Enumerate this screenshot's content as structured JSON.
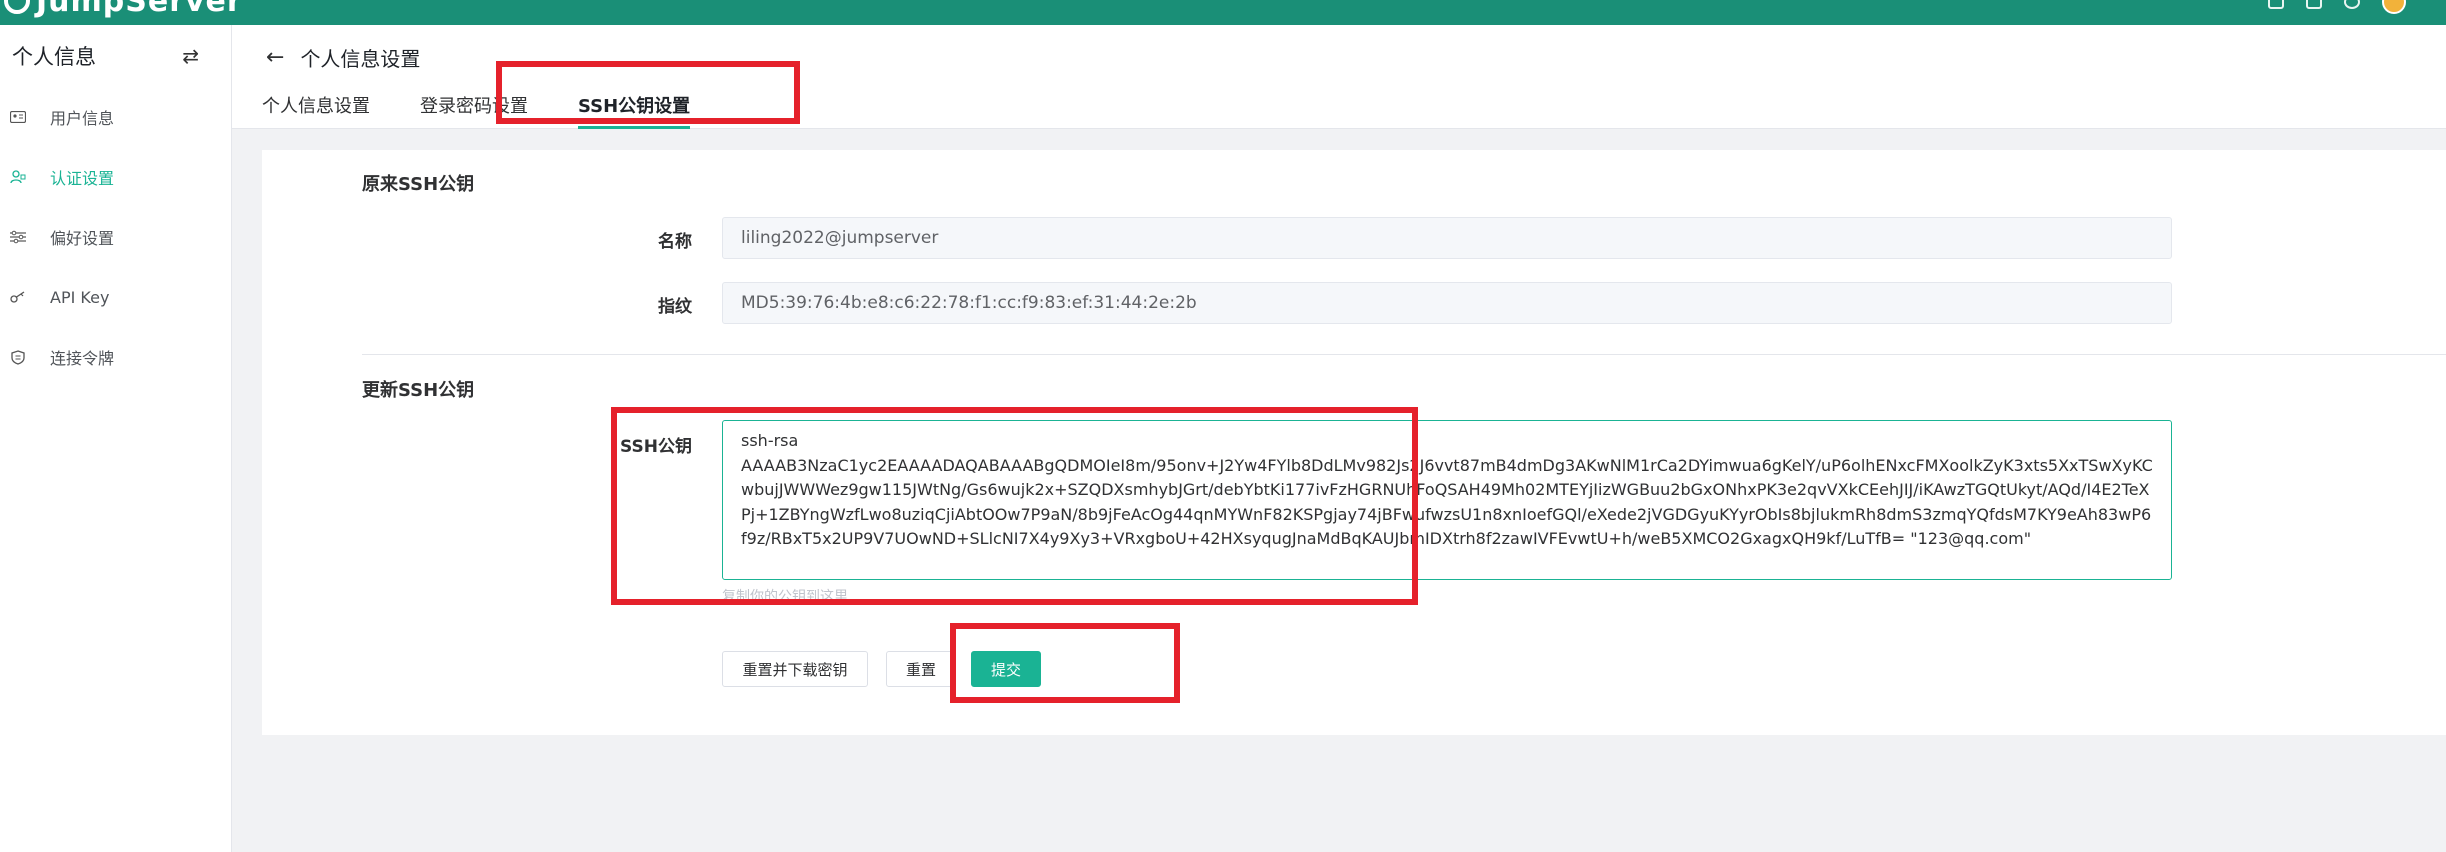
{
  "brand": {
    "name": "JumpServer"
  },
  "colors": {
    "brand": "#1a8f77",
    "accent": "#1ab394",
    "annotation": "#e5212b"
  },
  "sidebar": {
    "title": "个人信息",
    "toggle_icon": "swap-icon",
    "items": [
      {
        "label": "用户信息",
        "icon": "id-card-icon",
        "active": false
      },
      {
        "label": "认证设置",
        "icon": "user-lock-icon",
        "active": true
      },
      {
        "label": "偏好设置",
        "icon": "sliders-icon",
        "active": false
      },
      {
        "label": "API Key",
        "icon": "key-icon",
        "active": false
      },
      {
        "label": "连接令牌",
        "icon": "shield-icon",
        "active": false
      }
    ]
  },
  "header": {
    "title": "个人信息设置",
    "tabs": [
      {
        "label": "个人信息设置",
        "active": false
      },
      {
        "label": "登录密码设置",
        "active": false
      },
      {
        "label": "SSH公钥设置",
        "active": true
      }
    ]
  },
  "form": {
    "original_section_title": "原来SSH公钥",
    "name_label": "名称",
    "name_value": "liling2022@jumpserver",
    "fingerprint_label": "指纹",
    "fingerprint_value": "MD5:39:76:4b:e8:c6:22:78:f1:cc:f9:83:ef:31:44:2e:2b",
    "update_section_title": "更新SSH公钥",
    "pubkey_label": "SSH公钥",
    "pubkey_value": "ssh-rsa\nAAAAB3NzaC1yc2EAAAADAQABAAABgQDMOIeI8m/95onv+J2Yw4FYlb8DdLMv982Js2J6vvt87mB4dmDg3AKwNlM1rCa2DYimwua6gKelY/uP6olhENxcFMXoolkZyK3xts5XxTSwXyKCwbujJWWWez9gw115JWtNg/Gs6wujk2x+SZQDXsmhybJGrt/debYbtKi177ivFzHGRNUhFoQSAH49Mh02MTEYjIizWGBuu2bGxONhxPK3e2qvVXkCEehJIJ/iKAwzTGQtUkyt/AQd/I4E2TeXPj+1ZBYngWzfLwo8uziqCjiAbtOOw7P9aN/8b9jFeAcOg44qnMYWnF82KSPgjay74jBFwufwzsU1n8xnIoefGQl/eXede2jVGDGyuKYyrObIs8bjlukmRh8dmS3zmqYQfdsM7KY9eAh83wP6f9z/RBxT5x2UP9V7UOwND+SLlcNI7X4y9Xy3+VRxgboU+42HXsyqugJnaMdBqKAUJbmIDXtrh8f2zawIVFEvwtU+h/weB5XMCO2GxagxQH9kf/LuTfB= \"123@qq.com\"",
    "pubkey_hint": "复制你的公钥到这里",
    "btn_reset_download": "重置并下载密钥",
    "btn_reset": "重置",
    "btn_submit": "提交"
  }
}
